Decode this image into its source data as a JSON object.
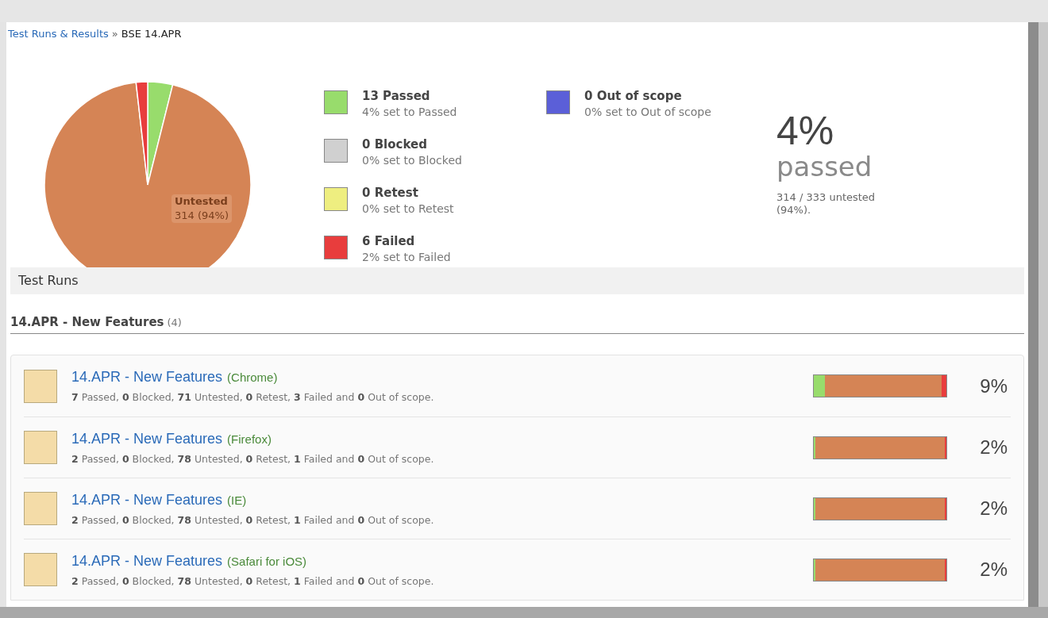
{
  "breadcrumb": {
    "link": "Test Runs & Results",
    "separator": "»",
    "current": "BSE 14.APR"
  },
  "summary": {
    "tooltip": {
      "title": "Untested",
      "value": "314 (94%)"
    },
    "legend": [
      {
        "kind": "passed",
        "title": "13 Passed",
        "subtitle": "4% set to Passed",
        "color": "#98dc6c"
      },
      {
        "kind": "blocked",
        "title": "0 Blocked",
        "subtitle": "0% set to Blocked",
        "color": "#d0d0d0"
      },
      {
        "kind": "retest",
        "title": "0 Retest",
        "subtitle": "0% set to Retest",
        "color": "#eeee80"
      },
      {
        "kind": "failed",
        "title": "6 Failed",
        "subtitle": "2% set to Failed",
        "color": "#e83d3d"
      },
      {
        "kind": "out_of_scope",
        "title": "0 Out of scope",
        "subtitle": "0% set to Out of scope",
        "color": "#5b5fd8"
      }
    ],
    "percent": "4%",
    "percent_label": "passed",
    "note": "314 / 333 untested (94%)."
  },
  "section_title": "Test Runs",
  "group": {
    "title": "14.APR - New Features",
    "count": "(4)"
  },
  "runs": [
    {
      "title": "14.APR - New Features",
      "config": "(Chrome)",
      "summary": "**7** Passed, **0** Blocked, **71** Untested, **0** Retest, **3** Failed and **0** Out of scope.",
      "percent": "9%",
      "bar": [
        {
          "kind": "passed",
          "level": 0.086
        },
        {
          "kind": "untested"
        },
        {
          "kind": "failed",
          "level": 0.037
        }
      ]
    },
    {
      "title": "14.APR - New Features",
      "config": "(Firefox)",
      "summary": "**2** Passed, **0** Blocked, **78** Untested, **0** Retest, **1** Failed and **0** Out of scope.",
      "percent": "2%",
      "bar": [
        {
          "kind": "passed",
          "level": 0.012
        },
        {
          "kind": "untested"
        },
        {
          "kind": "failed",
          "level": 0.013
        }
      ]
    },
    {
      "title": "14.APR - New Features",
      "config": "(IE)",
      "summary": "**2** Passed, **0** Blocked, **78** Untested, **0** Retest, **1** Failed and **0** Out of scope.",
      "percent": "2%",
      "bar": [
        {
          "kind": "passed",
          "level": 0.012
        },
        {
          "kind": "untested"
        },
        {
          "kind": "failed",
          "level": 0.013
        }
      ]
    },
    {
      "title": "14.APR - New Features",
      "config": "(Safari for iOS)",
      "summary": "**2** Passed, **0** Blocked, **78** Untested, **0** Retest, **1** Failed and **0** Out of scope.",
      "percent": "2%",
      "bar": [
        {
          "kind": "passed",
          "level": 0.012
        },
        {
          "kind": "untested"
        },
        {
          "kind": "failed",
          "level": 0.013
        }
      ]
    }
  ]
}
